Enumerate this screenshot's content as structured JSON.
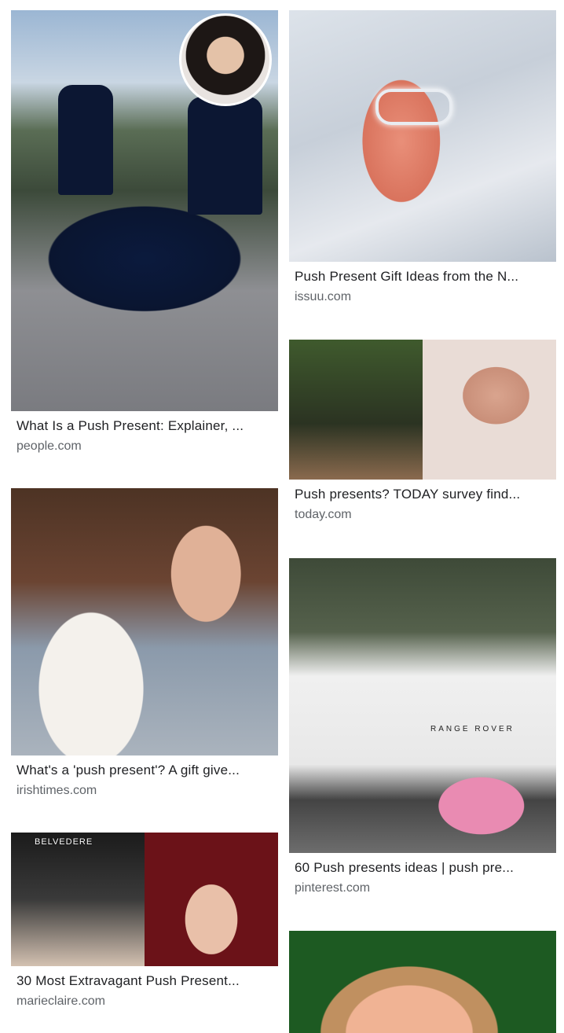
{
  "results": {
    "left": [
      {
        "title": "What Is a Push Present: Explainer, ...",
        "source": "people.com"
      },
      {
        "title": "What's a 'push present'? A gift give...",
        "source": "irishtimes.com"
      },
      {
        "title": "30 Most Extravagant Push Present...",
        "source": "marieclaire.com"
      }
    ],
    "right": [
      {
        "title": "Push Present Gift Ideas from the N...",
        "source": "issuu.com"
      },
      {
        "title": "Push presents? TODAY survey find...",
        "source": "today.com"
      },
      {
        "title": "60 Push presents ideas | push pre...",
        "source": "pinterest.com"
      },
      {
        "title": "",
        "source": ""
      }
    ]
  },
  "image_text": {
    "range_rover_badge": "RANGE ROVER",
    "belvedere_sign": "BELVEDERE"
  },
  "colors": {
    "title": "#202124",
    "source": "#5f6368",
    "background": "#ffffff"
  }
}
